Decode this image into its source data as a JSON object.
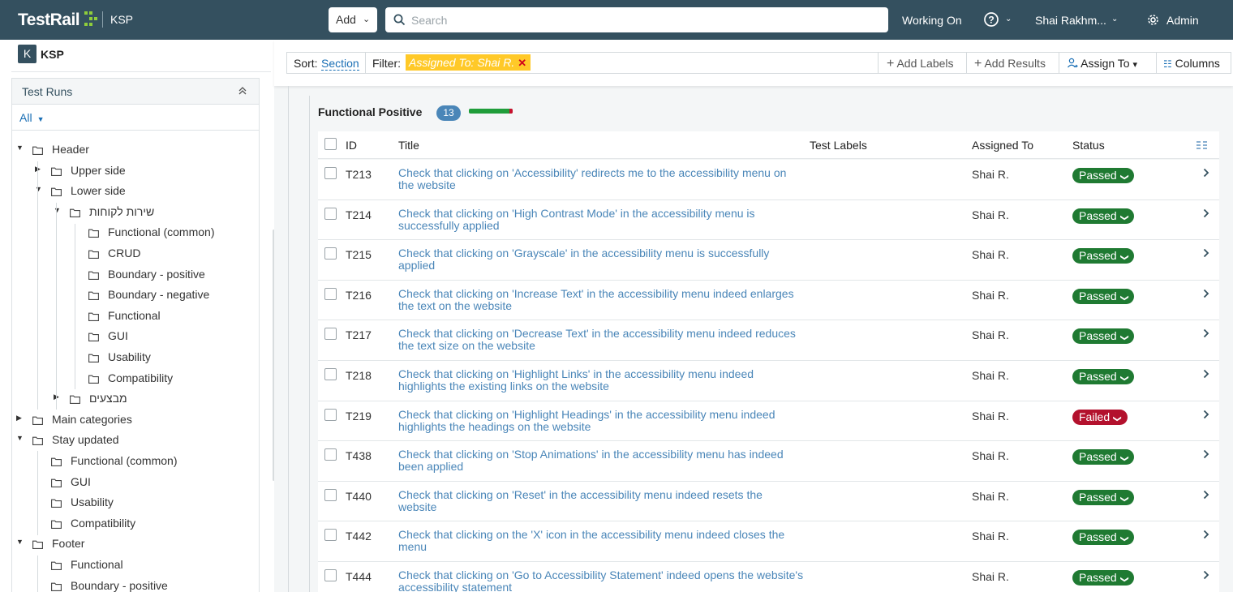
{
  "topbar": {
    "logo": "TestRail",
    "project": "KSP",
    "add_label": "Add",
    "search_placeholder": "Search",
    "working_on": "Working On",
    "user": "Shai Rakhm...",
    "admin": "Admin"
  },
  "sidebar": {
    "project_letter": "K",
    "project_name": "KSP",
    "panel_title": "Test Runs",
    "filter": "All",
    "tree": [
      {
        "label": "Header",
        "level": 0,
        "twist": "open"
      },
      {
        "label": "Upper side",
        "level": 1,
        "twist": "closed"
      },
      {
        "label": "Lower side",
        "level": 1,
        "twist": "open"
      },
      {
        "label": "שירות לקוחות",
        "level": 2,
        "twist": "open"
      },
      {
        "label": "Functional (common)",
        "level": 3,
        "twist": "none"
      },
      {
        "label": "CRUD",
        "level": 3,
        "twist": "none"
      },
      {
        "label": "Boundary - positive",
        "level": 3,
        "twist": "none"
      },
      {
        "label": "Boundary - negative",
        "level": 3,
        "twist": "none"
      },
      {
        "label": "Functional",
        "level": 3,
        "twist": "none"
      },
      {
        "label": "GUI",
        "level": 3,
        "twist": "none"
      },
      {
        "label": "Usability",
        "level": 3,
        "twist": "none"
      },
      {
        "label": "Compatibility",
        "level": 3,
        "twist": "none"
      },
      {
        "label": "מבצעים",
        "level": 2,
        "twist": "closed"
      },
      {
        "label": "Main categories",
        "level": 0,
        "twist": "closed"
      },
      {
        "label": "Stay updated",
        "level": 0,
        "twist": "open"
      },
      {
        "label": "Functional (common)",
        "level": 1,
        "twist": "none"
      },
      {
        "label": "GUI",
        "level": 1,
        "twist": "none"
      },
      {
        "label": "Usability",
        "level": 1,
        "twist": "none"
      },
      {
        "label": "Compatibility",
        "level": 1,
        "twist": "none"
      },
      {
        "label": "Footer",
        "level": 0,
        "twist": "open"
      },
      {
        "label": "Functional",
        "level": 1,
        "twist": "none"
      },
      {
        "label": "Boundary - positive",
        "level": 1,
        "twist": "none"
      }
    ]
  },
  "toolbar": {
    "sort_label": "Sort:",
    "sort_value": "Section",
    "filter_label": "Filter:",
    "filter_chip": "Assigned To: Shai R.",
    "add_labels": "Add Labels",
    "add_results": "Add Results",
    "assign_to": "Assign To",
    "columns": "Columns"
  },
  "section": {
    "title": "Functional Positive",
    "count": "13",
    "progress": {
      "passed": 12,
      "failed": 1
    }
  },
  "table": {
    "headers": {
      "id": "ID",
      "title": "Title",
      "labels": "Test Labels",
      "assigned": "Assigned To",
      "status": "Status"
    },
    "rows": [
      {
        "id": "T213",
        "title": "Check that clicking on 'Accessibility' redirects me to the accessibility menu on the website",
        "assigned": "Shai R.",
        "status": "Passed"
      },
      {
        "id": "T214",
        "title": "Check that clicking on 'High Contrast Mode' in the accessibility menu is successfully applied",
        "assigned": "Shai R.",
        "status": "Passed"
      },
      {
        "id": "T215",
        "title": "Check that clicking on 'Grayscale' in the accessibility menu is successfully applied",
        "assigned": "Shai R.",
        "status": "Passed"
      },
      {
        "id": "T216",
        "title": "Check that clicking on 'Increase Text' in the accessibility menu indeed enlarges the text on the website",
        "assigned": "Shai R.",
        "status": "Passed"
      },
      {
        "id": "T217",
        "title": "Check that clicking on 'Decrease Text' in the accessibility menu indeed reduces the text size on the website",
        "assigned": "Shai R.",
        "status": "Passed"
      },
      {
        "id": "T218",
        "title": "Check that clicking on 'Highlight Links' in the accessibility menu indeed highlights the existing links on the website",
        "assigned": "Shai R.",
        "status": "Passed"
      },
      {
        "id": "T219",
        "title": "Check that clicking on 'Highlight Headings' in the accessibility menu indeed highlights the headings on the website",
        "assigned": "Shai R.",
        "status": "Failed"
      },
      {
        "id": "T438",
        "title": "Check that clicking on 'Stop Animations' in the accessibility menu has indeed been applied",
        "assigned": "Shai R.",
        "status": "Passed"
      },
      {
        "id": "T440",
        "title": "Check that clicking on 'Reset' in the accessibility menu indeed resets the website",
        "assigned": "Shai R.",
        "status": "Passed"
      },
      {
        "id": "T442",
        "title": "Check that clicking on the 'X' icon in the accessibility menu indeed closes the menu",
        "assigned": "Shai R.",
        "status": "Passed"
      },
      {
        "id": "T444",
        "title": "Check that clicking on 'Go to Accessibility Statement' indeed opens the website's accessibility statement",
        "assigned": "Shai R.",
        "status": "Passed"
      }
    ]
  },
  "colors": {
    "topbar": "#34505f",
    "link": "#4a86b8",
    "passed": "#1f7a32",
    "failed": "#b3112d",
    "filter_chip": "#ffc928"
  }
}
